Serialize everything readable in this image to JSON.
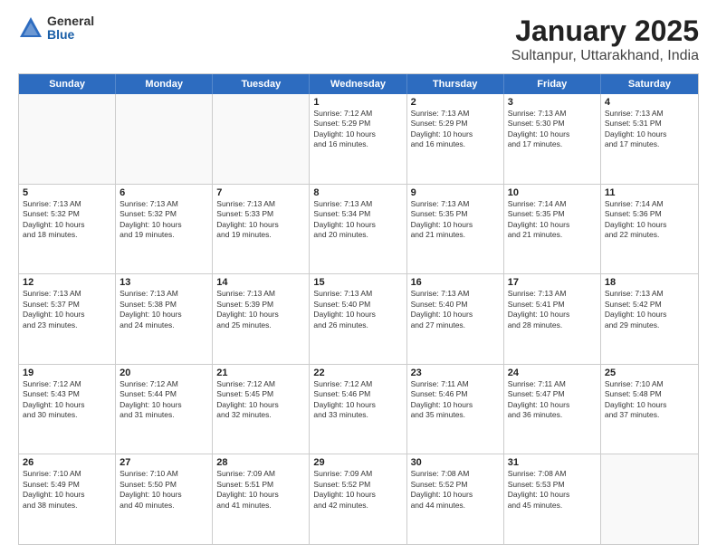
{
  "header": {
    "logo_general": "General",
    "logo_blue": "Blue",
    "title": "January 2025",
    "location": "Sultanpur, Uttarakhand, India"
  },
  "days_of_week": [
    "Sunday",
    "Monday",
    "Tuesday",
    "Wednesday",
    "Thursday",
    "Friday",
    "Saturday"
  ],
  "weeks": [
    [
      {
        "day": "",
        "text": ""
      },
      {
        "day": "",
        "text": ""
      },
      {
        "day": "",
        "text": ""
      },
      {
        "day": "1",
        "text": "Sunrise: 7:12 AM\nSunset: 5:29 PM\nDaylight: 10 hours\nand 16 minutes."
      },
      {
        "day": "2",
        "text": "Sunrise: 7:13 AM\nSunset: 5:29 PM\nDaylight: 10 hours\nand 16 minutes."
      },
      {
        "day": "3",
        "text": "Sunrise: 7:13 AM\nSunset: 5:30 PM\nDaylight: 10 hours\nand 17 minutes."
      },
      {
        "day": "4",
        "text": "Sunrise: 7:13 AM\nSunset: 5:31 PM\nDaylight: 10 hours\nand 17 minutes."
      }
    ],
    [
      {
        "day": "5",
        "text": "Sunrise: 7:13 AM\nSunset: 5:32 PM\nDaylight: 10 hours\nand 18 minutes."
      },
      {
        "day": "6",
        "text": "Sunrise: 7:13 AM\nSunset: 5:32 PM\nDaylight: 10 hours\nand 19 minutes."
      },
      {
        "day": "7",
        "text": "Sunrise: 7:13 AM\nSunset: 5:33 PM\nDaylight: 10 hours\nand 19 minutes."
      },
      {
        "day": "8",
        "text": "Sunrise: 7:13 AM\nSunset: 5:34 PM\nDaylight: 10 hours\nand 20 minutes."
      },
      {
        "day": "9",
        "text": "Sunrise: 7:13 AM\nSunset: 5:35 PM\nDaylight: 10 hours\nand 21 minutes."
      },
      {
        "day": "10",
        "text": "Sunrise: 7:14 AM\nSunset: 5:35 PM\nDaylight: 10 hours\nand 21 minutes."
      },
      {
        "day": "11",
        "text": "Sunrise: 7:14 AM\nSunset: 5:36 PM\nDaylight: 10 hours\nand 22 minutes."
      }
    ],
    [
      {
        "day": "12",
        "text": "Sunrise: 7:13 AM\nSunset: 5:37 PM\nDaylight: 10 hours\nand 23 minutes."
      },
      {
        "day": "13",
        "text": "Sunrise: 7:13 AM\nSunset: 5:38 PM\nDaylight: 10 hours\nand 24 minutes."
      },
      {
        "day": "14",
        "text": "Sunrise: 7:13 AM\nSunset: 5:39 PM\nDaylight: 10 hours\nand 25 minutes."
      },
      {
        "day": "15",
        "text": "Sunrise: 7:13 AM\nSunset: 5:40 PM\nDaylight: 10 hours\nand 26 minutes."
      },
      {
        "day": "16",
        "text": "Sunrise: 7:13 AM\nSunset: 5:40 PM\nDaylight: 10 hours\nand 27 minutes."
      },
      {
        "day": "17",
        "text": "Sunrise: 7:13 AM\nSunset: 5:41 PM\nDaylight: 10 hours\nand 28 minutes."
      },
      {
        "day": "18",
        "text": "Sunrise: 7:13 AM\nSunset: 5:42 PM\nDaylight: 10 hours\nand 29 minutes."
      }
    ],
    [
      {
        "day": "19",
        "text": "Sunrise: 7:12 AM\nSunset: 5:43 PM\nDaylight: 10 hours\nand 30 minutes."
      },
      {
        "day": "20",
        "text": "Sunrise: 7:12 AM\nSunset: 5:44 PM\nDaylight: 10 hours\nand 31 minutes."
      },
      {
        "day": "21",
        "text": "Sunrise: 7:12 AM\nSunset: 5:45 PM\nDaylight: 10 hours\nand 32 minutes."
      },
      {
        "day": "22",
        "text": "Sunrise: 7:12 AM\nSunset: 5:46 PM\nDaylight: 10 hours\nand 33 minutes."
      },
      {
        "day": "23",
        "text": "Sunrise: 7:11 AM\nSunset: 5:46 PM\nDaylight: 10 hours\nand 35 minutes."
      },
      {
        "day": "24",
        "text": "Sunrise: 7:11 AM\nSunset: 5:47 PM\nDaylight: 10 hours\nand 36 minutes."
      },
      {
        "day": "25",
        "text": "Sunrise: 7:10 AM\nSunset: 5:48 PM\nDaylight: 10 hours\nand 37 minutes."
      }
    ],
    [
      {
        "day": "26",
        "text": "Sunrise: 7:10 AM\nSunset: 5:49 PM\nDaylight: 10 hours\nand 38 minutes."
      },
      {
        "day": "27",
        "text": "Sunrise: 7:10 AM\nSunset: 5:50 PM\nDaylight: 10 hours\nand 40 minutes."
      },
      {
        "day": "28",
        "text": "Sunrise: 7:09 AM\nSunset: 5:51 PM\nDaylight: 10 hours\nand 41 minutes."
      },
      {
        "day": "29",
        "text": "Sunrise: 7:09 AM\nSunset: 5:52 PM\nDaylight: 10 hours\nand 42 minutes."
      },
      {
        "day": "30",
        "text": "Sunrise: 7:08 AM\nSunset: 5:52 PM\nDaylight: 10 hours\nand 44 minutes."
      },
      {
        "day": "31",
        "text": "Sunrise: 7:08 AM\nSunset: 5:53 PM\nDaylight: 10 hours\nand 45 minutes."
      },
      {
        "day": "",
        "text": ""
      }
    ]
  ]
}
